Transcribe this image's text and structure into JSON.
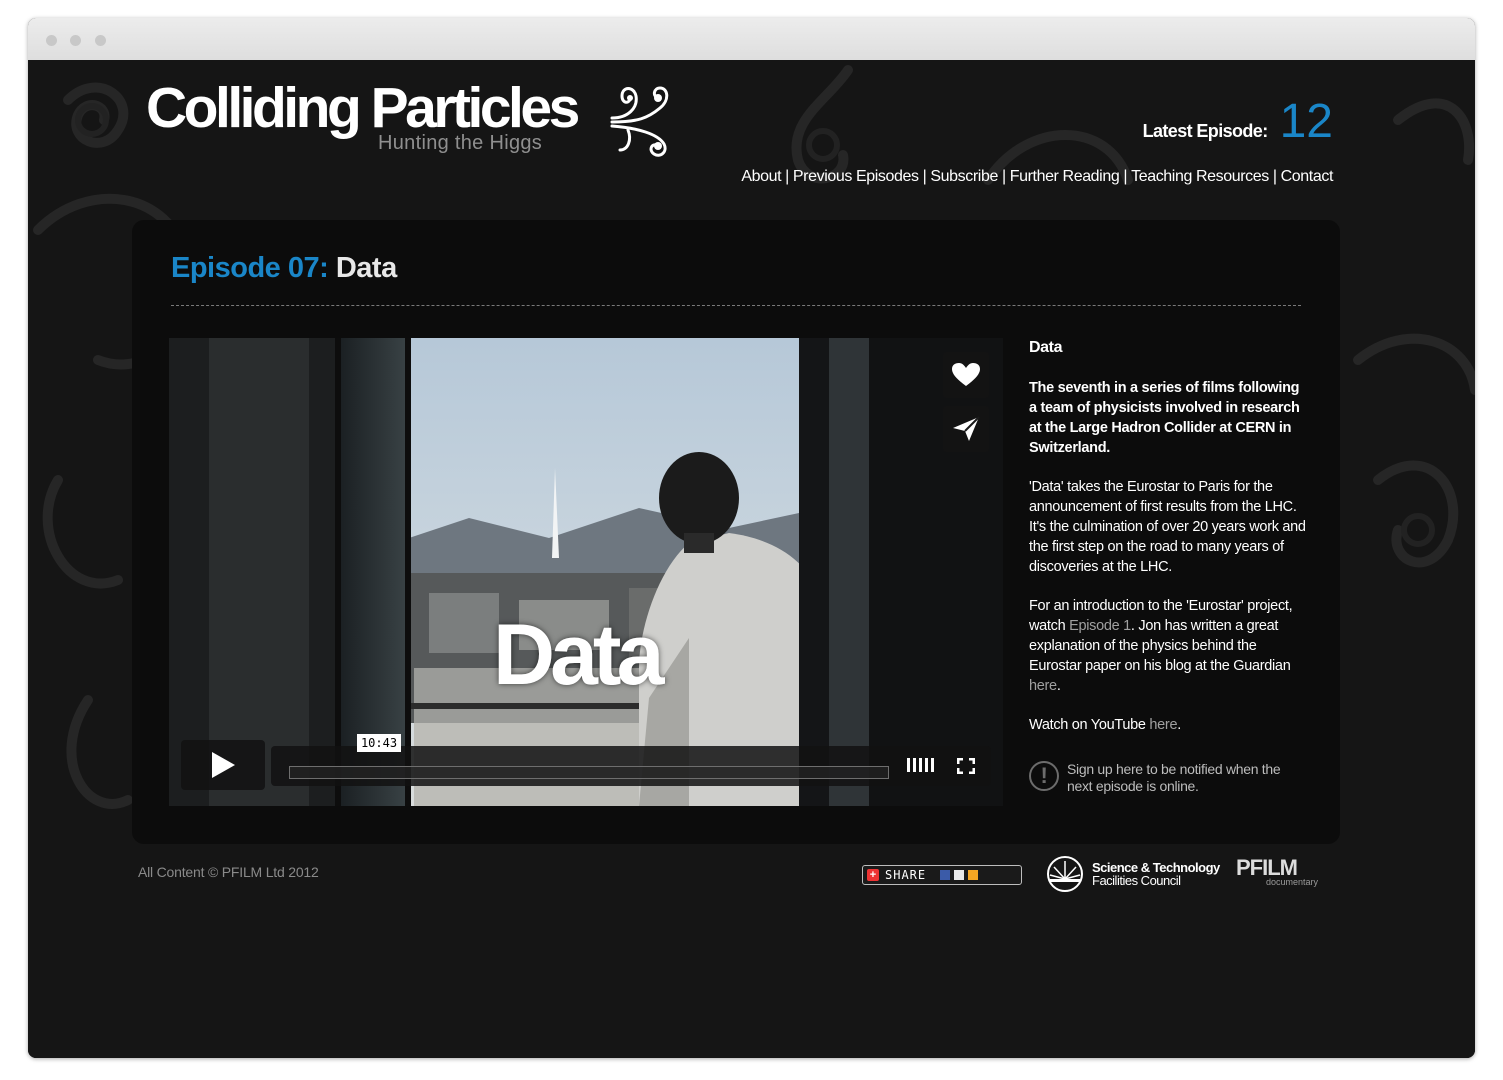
{
  "site": {
    "logo_title": "Colliding Particles",
    "logo_subtitle": "Hunting the Higgs",
    "latest_label": "Latest Episode:",
    "latest_number": "12",
    "accent_color": "#1a86c8"
  },
  "nav": {
    "items": [
      "About",
      "Previous Episodes",
      "Subscribe",
      "Further Reading",
      "Teaching Resources",
      "Contact"
    ],
    "separator": "|"
  },
  "episode": {
    "number_label": "Episode 07:",
    "title": "Data"
  },
  "video": {
    "overlay_text": "Data",
    "time": "10:43",
    "progress": 0,
    "icons": [
      "heart-icon",
      "send-icon",
      "play-icon",
      "volume-icon",
      "fullscreen-icon"
    ]
  },
  "info": {
    "heading": "Data",
    "lead": "The seventh in a series of films following a team of physicists involved in research at the Large Hadron Collider at CERN in Switzerland.",
    "p2": "'Data' takes the Eurostar to Paris for the announcement of first results from the LHC.  It's the culmination of over 20 years work and the first step on the road to many years of discoveries at the LHC.",
    "p3_a": "For an introduction to the 'Eurostar' project, watch ",
    "p3_link1": "Episode 1",
    "p3_b": ".  Jon has written a great explanation of the physics behind the Eurostar paper on his blog at the Guardian ",
    "p3_link2": "here",
    "p3_c": ".",
    "p4_a": "Watch on YouTube ",
    "p4_link": "here",
    "p4_b": ".",
    "notify": "Sign up here to be notified when the next episode is online."
  },
  "footer": {
    "copyright": "All Content © PFILM Ltd 2012",
    "share_label": "SHARE",
    "stfc_line1": "Science & Technology",
    "stfc_line2": "Facilities Council",
    "pfilm_big": "PFILM",
    "pfilm_small": "documentary"
  }
}
